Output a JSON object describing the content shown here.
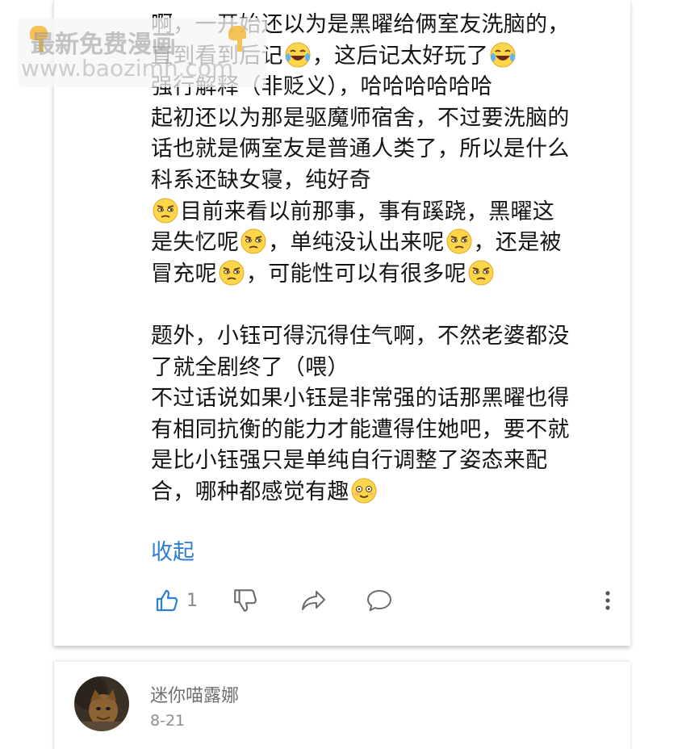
{
  "watermark": {
    "line1": "最新免费漫画",
    "line2": "www.baozimh.com"
  },
  "comment": {
    "lines": [
      {
        "segments": [
          {
            "t": "text",
            "v": "啊，一开始还以为是黑曜给俩室友洗脑的，"
          }
        ]
      },
      {
        "segments": [
          {
            "t": "text",
            "v": "直到看到后记"
          },
          {
            "t": "emoji",
            "v": "laugh-cry-emoji"
          },
          {
            "t": "text",
            "v": "，这后记太好玩了"
          },
          {
            "t": "emoji",
            "v": "laugh-cry-emoji"
          }
        ]
      },
      {
        "segments": [
          {
            "t": "text",
            "v": "强行解释（非贬义），哈哈哈哈哈哈"
          }
        ]
      },
      {
        "segments": [
          {
            "t": "text",
            "v": "起初还以为那是驱魔师宿舍，不过要洗脑的"
          }
        ]
      },
      {
        "segments": [
          {
            "t": "text",
            "v": "话也就是俩室友是普通人类了，所以是什么"
          }
        ]
      },
      {
        "segments": [
          {
            "t": "text",
            "v": "科系还缺女寝，纯好奇"
          }
        ]
      },
      {
        "segments": [
          {
            "t": "emoji",
            "v": "skeptical-emoji"
          },
          {
            "t": "text",
            "v": "目前来看以前那事，事有蹊跷，黑曜这"
          }
        ]
      },
      {
        "segments": [
          {
            "t": "text",
            "v": "是失忆呢"
          },
          {
            "t": "emoji",
            "v": "skeptical-emoji"
          },
          {
            "t": "text",
            "v": "，单纯没认出来呢"
          },
          {
            "t": "emoji",
            "v": "skeptical-emoji"
          },
          {
            "t": "text",
            "v": "，还是被"
          }
        ]
      },
      {
        "segments": [
          {
            "t": "text",
            "v": "冒充呢"
          },
          {
            "t": "emoji",
            "v": "skeptical-emoji"
          },
          {
            "t": "text",
            "v": "，可能性可以有很多呢"
          },
          {
            "t": "emoji",
            "v": "skeptical-emoji"
          }
        ]
      },
      {
        "segments": []
      },
      {
        "segments": [
          {
            "t": "text",
            "v": "题外，小钰可得沉得住气啊，不然老婆都没"
          }
        ]
      },
      {
        "segments": [
          {
            "t": "text",
            "v": "了就全剧终了（喂）"
          }
        ]
      },
      {
        "segments": [
          {
            "t": "text",
            "v": "不过话说如果小钰是非常强的话那黑曜也得"
          }
        ]
      },
      {
        "segments": [
          {
            "t": "text",
            "v": "有相同抗衡的能力才能遭得住她吧，要不就"
          }
        ]
      },
      {
        "segments": [
          {
            "t": "text",
            "v": "是比小钰强只是单纯自行调整了姿态来配"
          }
        ]
      },
      {
        "segments": [
          {
            "t": "text",
            "v": "合，哪种都感觉有趣"
          },
          {
            "t": "emoji",
            "v": "smile-emoji"
          }
        ]
      }
    ],
    "collapse_label": "收起",
    "like_count": "1"
  },
  "next_comment": {
    "username": "迷你喵露娜",
    "date": "8-21"
  },
  "colors": {
    "link_blue": "#2d7fd6",
    "text": "#141414",
    "muted": "#8a8a8a"
  },
  "icons": {
    "like": "thumbs-up-icon",
    "dislike": "thumbs-down-icon",
    "share": "share-icon",
    "comment": "comment-icon",
    "more": "more-vertical-icon"
  }
}
